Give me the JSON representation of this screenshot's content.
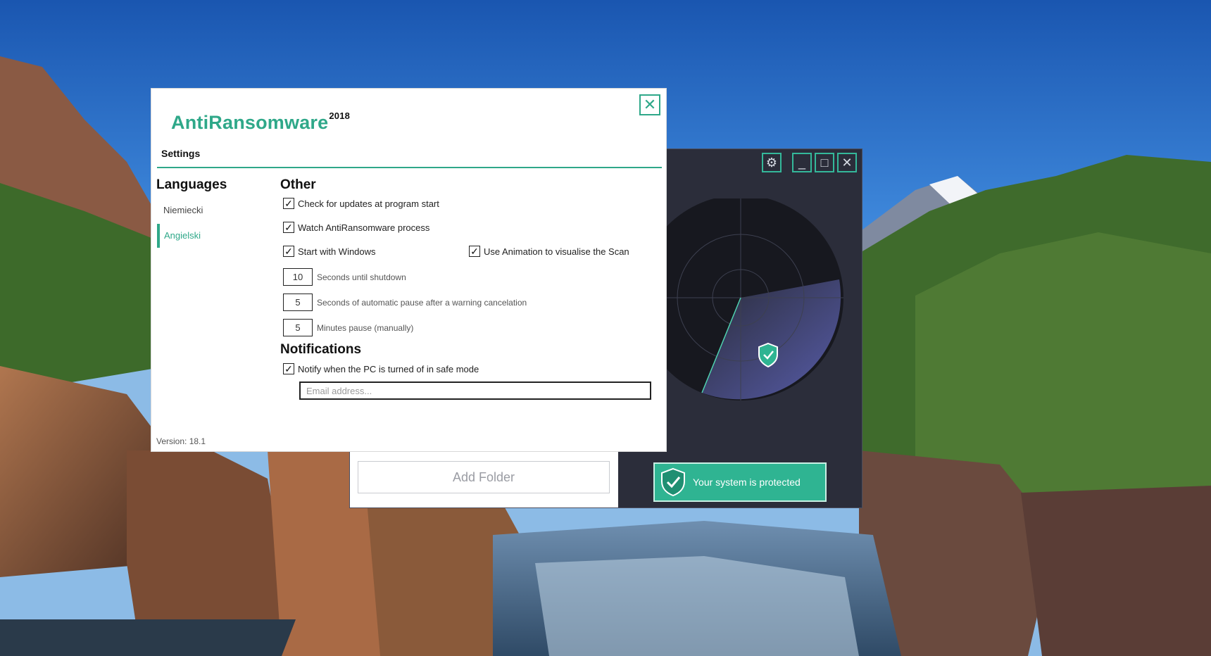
{
  "settings": {
    "app_name": "AntiRansomware",
    "app_year": "2018",
    "close_glyph": "✕",
    "tab_label": "Settings",
    "languages": {
      "heading": "Languages",
      "items": [
        {
          "label": "Niemiecki",
          "active": false
        },
        {
          "label": "Angielski",
          "active": true
        }
      ]
    },
    "other": {
      "heading": "Other",
      "checkboxes": [
        {
          "label": "Check for updates at program start",
          "checked": true
        },
        {
          "label": "Watch AntiRansomware process",
          "checked": true
        },
        {
          "label": "Start with Windows",
          "checked": true
        },
        {
          "label": "Use Animation to visualise the Scan",
          "checked": true
        }
      ],
      "numeric_fields": [
        {
          "value": "10",
          "label": "Seconds until shutdown"
        },
        {
          "value": "5",
          "label": "Seconds of automatic pause after a warning cancelation"
        },
        {
          "value": "5",
          "label": "Minutes pause (manually)"
        }
      ]
    },
    "notifications": {
      "heading": "Notifications",
      "checkbox": {
        "label": "Notify when the PC is turned of in safe mode",
        "checked": true
      },
      "email_placeholder": "Email address...",
      "email_value": ""
    },
    "version": "Version: 18.1"
  },
  "main_window": {
    "title_buttons": [
      {
        "icon": "gear-icon",
        "glyph": "⚙"
      },
      {
        "icon": "minimize-icon",
        "glyph": "_"
      },
      {
        "icon": "maximize-icon",
        "glyph": "□"
      },
      {
        "icon": "close-icon",
        "glyph": "✕"
      }
    ],
    "add_folder_label": "Add Folder",
    "status_text": "Your system is protected"
  },
  "colors": {
    "accent": "#2fa889",
    "dark_bg": "#2b2d3a",
    "status_green": "#2fb492"
  }
}
